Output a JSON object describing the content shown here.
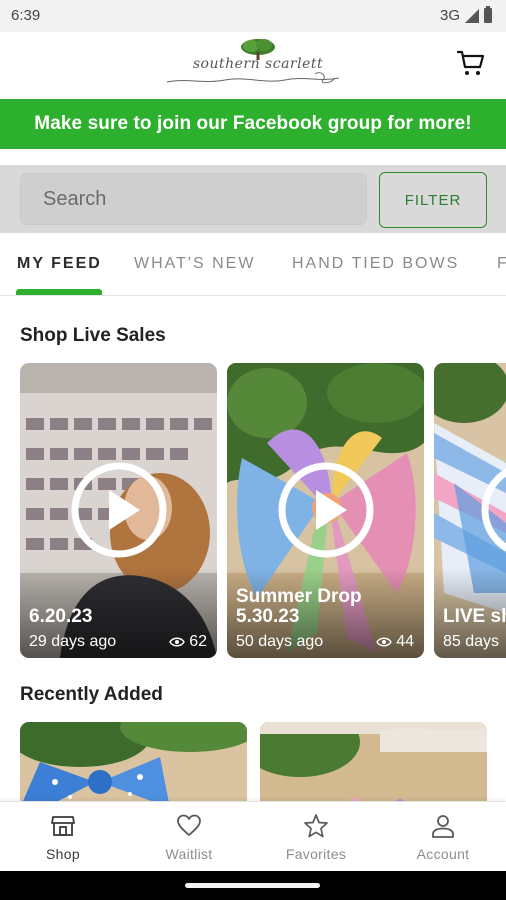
{
  "status_bar": {
    "time": "6:39",
    "network": "3G"
  },
  "header": {
    "logo_text": "southern scarlett"
  },
  "promo": {
    "text": "Make sure to join our Facebook group for more!"
  },
  "search": {
    "placeholder": "Search",
    "filter_label": "FILTER"
  },
  "tabs": [
    {
      "label": "MY FEED",
      "active": true
    },
    {
      "label": "WHAT'S NEW",
      "active": false
    },
    {
      "label": "HAND TIED BOWS",
      "active": false
    },
    {
      "label": "F",
      "active": false
    }
  ],
  "live_sales": {
    "title": "Shop Live Sales",
    "cards": [
      {
        "title": "6.20.23",
        "age": "29 days ago",
        "views": "62"
      },
      {
        "title": "Summer Drop\n5.30.23",
        "age": "50 days ago",
        "views": "44"
      },
      {
        "title": "LIVE sh",
        "age": "85 days"
      }
    ]
  },
  "recent": {
    "title": "Recently Added"
  },
  "bottom_nav": [
    {
      "label": "Shop",
      "icon": "store-icon",
      "active": true
    },
    {
      "label": "Waitlist",
      "icon": "heart-icon",
      "active": false
    },
    {
      "label": "Favorites",
      "icon": "star-icon",
      "active": false
    },
    {
      "label": "Account",
      "icon": "person-icon",
      "active": false
    }
  ],
  "colors": {
    "brand_green": "#2db02d",
    "filter_green": "#2e8b2e"
  }
}
